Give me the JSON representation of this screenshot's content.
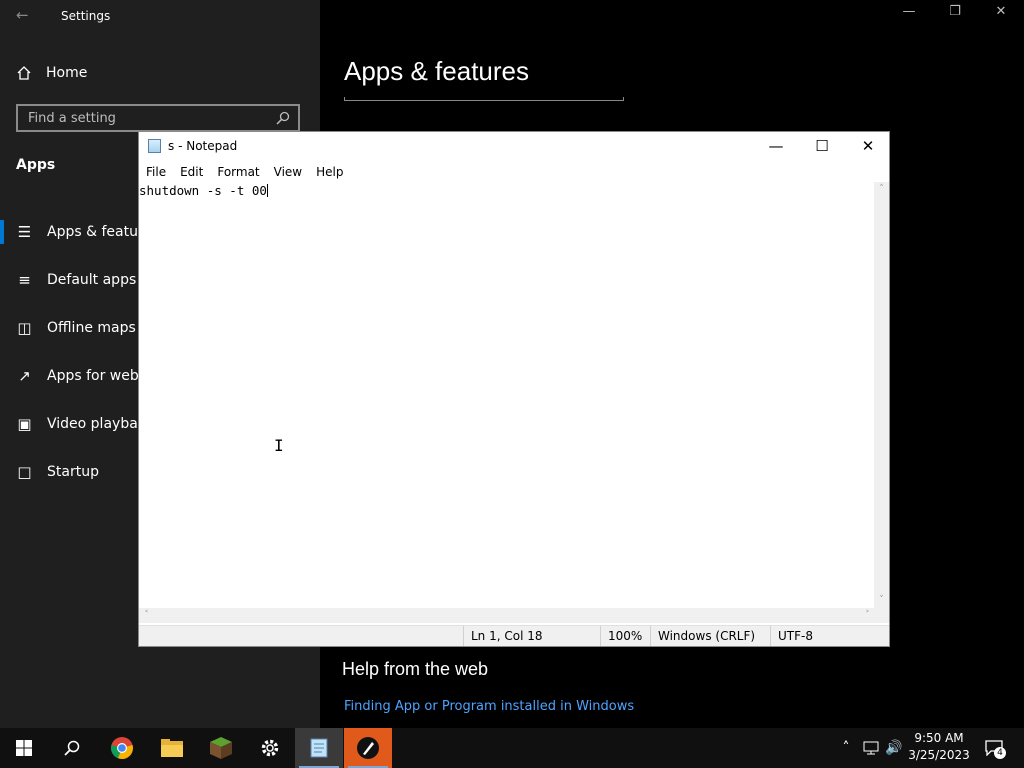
{
  "settings": {
    "window_title": "Settings",
    "home_label": "Home",
    "search_placeholder": "Find a setting",
    "section_title": "Apps",
    "nav": [
      {
        "label": "Apps & features",
        "icon": "list-icon"
      },
      {
        "label": "Default apps",
        "icon": "default-apps-icon"
      },
      {
        "label": "Offline maps",
        "icon": "map-icon"
      },
      {
        "label": "Apps for websites",
        "icon": "web-link-icon"
      },
      {
        "label": "Video playback",
        "icon": "video-icon"
      },
      {
        "label": "Startup",
        "icon": "startup-icon"
      }
    ],
    "page_title": "Apps & features",
    "help_heading": "Help from the web",
    "help_link": "Finding App or Program installed in Windows"
  },
  "notepad": {
    "title": "s - Notepad",
    "menu": [
      "File",
      "Edit",
      "Format",
      "View",
      "Help"
    ],
    "text": "shutdown -s -t 00",
    "status": {
      "position": "Ln 1, Col 18",
      "zoom": "100%",
      "line_ending": "Windows (CRLF)",
      "encoding": "UTF-8"
    }
  },
  "taskbar": {
    "apps": [
      "start-icon",
      "search-icon",
      "chrome-icon",
      "file-explorer-icon",
      "minecraft-icon",
      "settings-icon",
      "notepad-icon",
      "pen-app-icon"
    ],
    "time": "9:50 AM",
    "date": "3/25/2023",
    "notification_count": "4"
  },
  "colors": {
    "accent": "#0078d4",
    "link": "#4ea4ff",
    "sidebar_bg": "#1f1f1f",
    "taskbar_bg": "#101010"
  }
}
